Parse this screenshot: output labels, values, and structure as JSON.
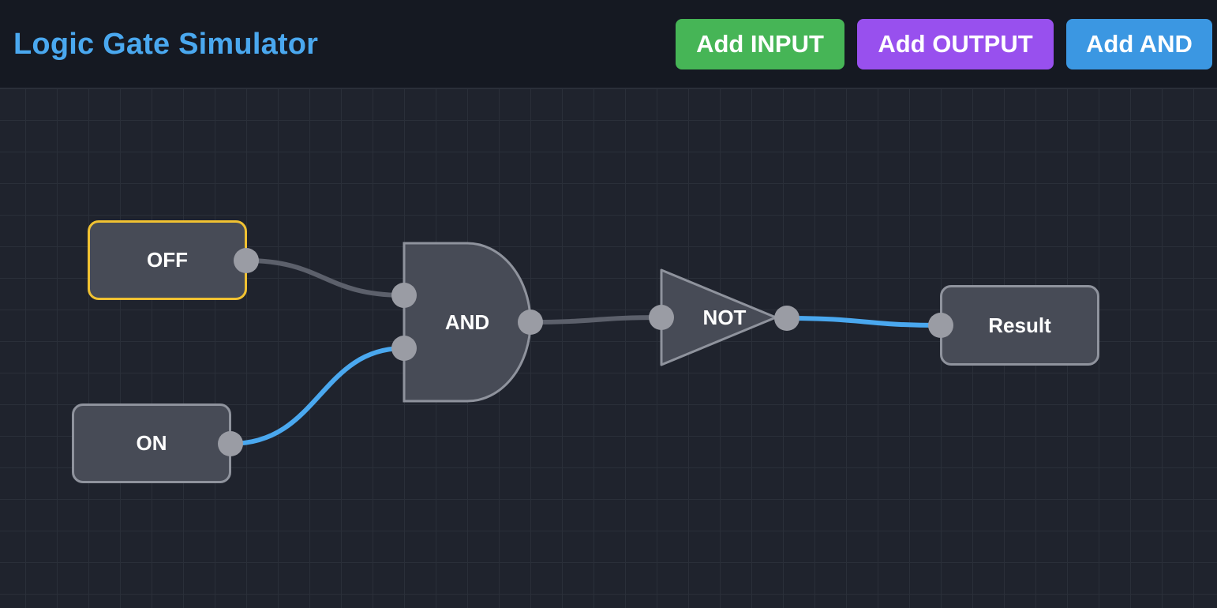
{
  "app": {
    "title": "Logic Gate Simulator"
  },
  "toolbar": {
    "add_input_label": "Add INPUT",
    "add_output_label": "Add OUTPUT",
    "add_and_label": "Add AND"
  },
  "circuit": {
    "inputs": [
      {
        "label": "OFF",
        "state": false,
        "selected": true
      },
      {
        "label": "ON",
        "state": true,
        "selected": false
      }
    ],
    "gates": [
      {
        "type": "AND",
        "label": "AND"
      },
      {
        "type": "NOT",
        "label": "NOT"
      }
    ],
    "outputs": [
      {
        "label": "Result"
      }
    ],
    "wires": [
      {
        "from": "OFF",
        "to": "AND input 1",
        "active": false
      },
      {
        "from": "ON",
        "to": "AND input 2",
        "active": true
      },
      {
        "from": "AND",
        "to": "NOT",
        "active": false
      },
      {
        "from": "NOT",
        "to": "Result",
        "active": true
      }
    ]
  },
  "colors": {
    "title": "#4aa8ef",
    "add_input": "#46b556",
    "add_output": "#9850ee",
    "add_and": "#3b97e2",
    "wire_active": "#4aa8ef",
    "wire_inactive": "#5c606b",
    "selected_border": "#f1c232"
  }
}
